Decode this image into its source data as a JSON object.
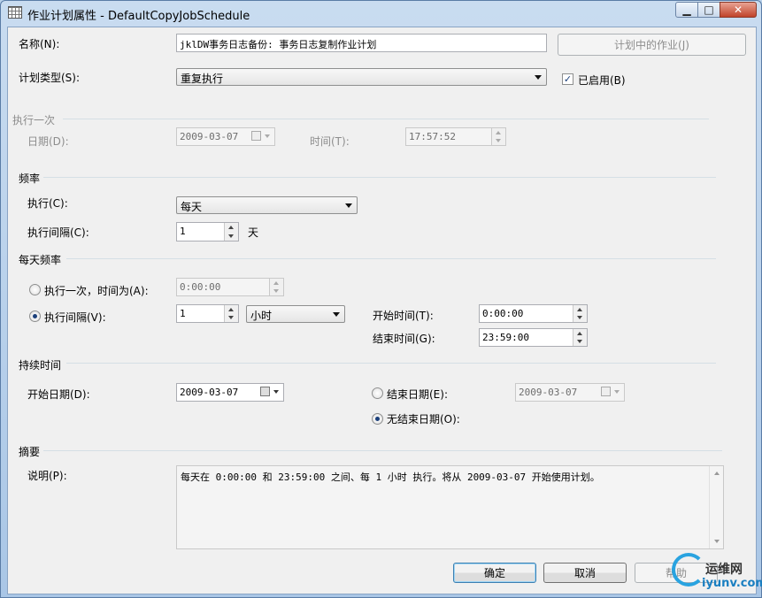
{
  "window": {
    "title": "作业计划属性 - DefaultCopyJobSchedule",
    "minimize_glyph": "▁",
    "maximize_glyph": "□",
    "close_glyph": "✕"
  },
  "name": {
    "label": "名称(N):",
    "value": "jklDW事务日志备份: 事务日志复制作业计划"
  },
  "jobs_in_schedule_button": "计划中的作业(J)",
  "schedule_type": {
    "label": "计划类型(S):",
    "value": "重复执行"
  },
  "enabled": {
    "label": "已启用(B)",
    "checked_glyph": "✓"
  },
  "one_time": {
    "section": "执行一次",
    "date_label": "日期(D):",
    "date_value": "2009-03-07",
    "time_label": "时间(T):",
    "time_value": "17:57:52"
  },
  "frequency": {
    "section": "频率",
    "occurs_label": "执行(C):",
    "occurs_value": "每天",
    "recurs_label": "执行间隔(C):",
    "recurs_value": "1",
    "recurs_unit": "天"
  },
  "daily_frequency": {
    "section": "每天频率",
    "once_label": "执行一次，时间为(A):",
    "once_value": "0:00:00",
    "every_label": "执行间隔(V):",
    "every_value": "1",
    "every_unit": "小时",
    "start_time_label": "开始时间(T):",
    "start_time_value": "0:00:00",
    "end_time_label": "结束时间(G):",
    "end_time_value": "23:59:00"
  },
  "duration": {
    "section": "持续时间",
    "start_date_label": "开始日期(D):",
    "start_date_value": "2009-03-07",
    "end_date_label": "结束日期(E):",
    "end_date_value": "2009-03-07",
    "no_end_label": "无结束日期(O):"
  },
  "summary": {
    "section": "摘要",
    "description_label": "说明(P):",
    "description_value": "每天在 0:00:00 和 23:59:00 之间、每 1 小时 执行。将从 2009-03-07 开始使用计划。"
  },
  "buttons": {
    "ok": "确定",
    "cancel": "取消",
    "help": "帮助"
  },
  "watermark": {
    "cn": "运维网",
    "en": "iyunv.com"
  }
}
